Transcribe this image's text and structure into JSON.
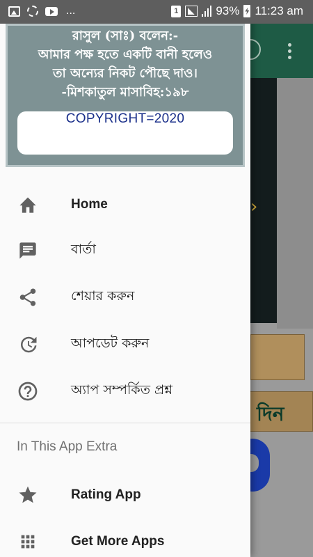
{
  "status_bar": {
    "left_icons": [
      "image-icon",
      "sync-icon",
      "youtube-icon"
    ],
    "overflow": "...",
    "sim_slot": "1",
    "battery_percent": "93%",
    "time": "11:23 am"
  },
  "drawer": {
    "header": {
      "quote_lines": [
        "রাসুল (সাঃ) বলেন:-",
        "আমার পক্ষ হতে একটি বানী হলেও",
        "তা অন্যের নিকট পৌছে দাও।",
        "-মিশকাতুল মাসাবিহ:১৯৮"
      ],
      "copyright": "COPYRIGHT=2020",
      "background_color": "#7e9294"
    },
    "items": [
      {
        "label": "Home",
        "icon": "home-icon"
      },
      {
        "label": "বার্তা",
        "icon": "message-icon"
      },
      {
        "label": "শেয়ার করুন",
        "icon": "share-icon"
      },
      {
        "label": "আপডেট করুন",
        "icon": "update-icon"
      },
      {
        "label": "অ্যাপ সম্পর্কিত প্রশ্ন",
        "icon": "help-icon"
      }
    ],
    "section_title": "In This App Extra",
    "extra_items": [
      {
        "label": "Rating App",
        "icon": "star-icon"
      },
      {
        "label": "Get More Apps",
        "icon": "apps-grid-icon"
      }
    ]
  },
  "background_app": {
    "visible_text": "দিন",
    "toolbar_color": "#1e5b45"
  }
}
